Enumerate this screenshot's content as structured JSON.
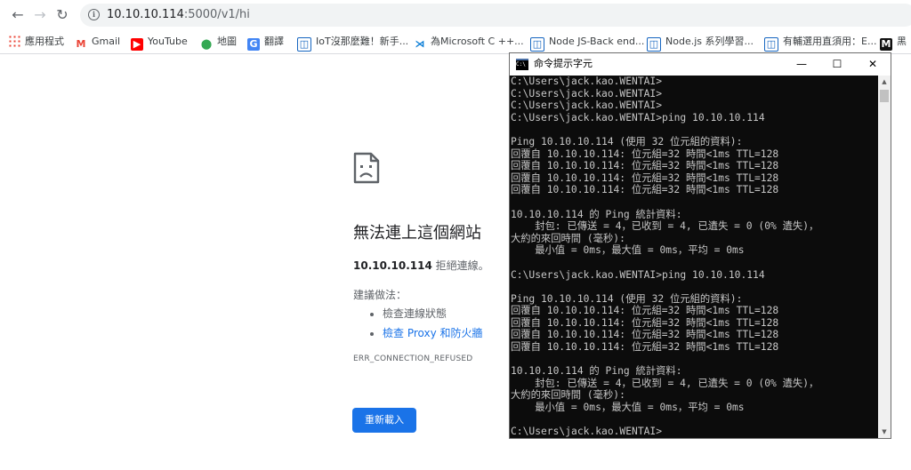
{
  "browser": {
    "nav": {
      "back": "←",
      "forward": "→",
      "reload": "↻"
    },
    "url_host": "10.10.10.114",
    "url_rest": ":5000/v1/hi",
    "bookmarks": [
      {
        "label": "應用程式",
        "icon": "apps-icon"
      },
      {
        "label": "Gmail",
        "icon": "gmail-icon"
      },
      {
        "label": "YouTube",
        "icon": "youtube-icon"
      },
      {
        "label": "地圖",
        "icon": "maps-icon"
      },
      {
        "label": "翻譯",
        "icon": "translate-icon"
      },
      {
        "label": "IoT沒那麼難！新手...",
        "icon": "site-icon"
      },
      {
        "label": "為Microsoft C ++...",
        "icon": "vscode-icon"
      },
      {
        "label": "Node JS-Back end...",
        "icon": "site-icon"
      },
      {
        "label": "Node.js 系列學習...",
        "icon": "site-icon"
      },
      {
        "label": "有輔選用直須用：E...",
        "icon": "site-icon"
      },
      {
        "label": "黑",
        "icon": "dark-site-icon"
      }
    ]
  },
  "error_page": {
    "title": "無法連上這個網站",
    "host": "10.10.10.114",
    "message": " 拒絕連線。",
    "suggestions_label": "建議做法：",
    "suggestions": [
      "檢查連線狀態",
      "檢查 Proxy 和防火牆"
    ],
    "error_code": "ERR_CONNECTION_REFUSED",
    "reload_label": "重新載入"
  },
  "cmd_window": {
    "title": "命令提示字元",
    "buttons": {
      "minimize": "—",
      "maximize": "☐",
      "close": "✕"
    },
    "lines": [
      "C:\\Users\\jack.kao.WENTAI>",
      "C:\\Users\\jack.kao.WENTAI>",
      "C:\\Users\\jack.kao.WENTAI>",
      "C:\\Users\\jack.kao.WENTAI>ping 10.10.10.114",
      "",
      "Ping 10.10.10.114 (使用 32 位元組的資料):",
      "回覆自 10.10.10.114: 位元組=32 時間<1ms TTL=128",
      "回覆自 10.10.10.114: 位元組=32 時間<1ms TTL=128",
      "回覆自 10.10.10.114: 位元組=32 時間<1ms TTL=128",
      "回覆自 10.10.10.114: 位元組=32 時間<1ms TTL=128",
      "",
      "10.10.10.114 的 Ping 統計資料:",
      "    封包: 已傳送 = 4，已收到 = 4, 已遺失 = 0 (0% 遺失)，",
      "大約的來回時間 (毫秒):",
      "    最小值 = 0ms，最大值 = 0ms，平均 = 0ms",
      "",
      "C:\\Users\\jack.kao.WENTAI>ping 10.10.10.114",
      "",
      "Ping 10.10.10.114 (使用 32 位元組的資料):",
      "回覆自 10.10.10.114: 位元組=32 時間<1ms TTL=128",
      "回覆自 10.10.10.114: 位元組=32 時間<1ms TTL=128",
      "回覆自 10.10.10.114: 位元組=32 時間<1ms TTL=128",
      "回覆自 10.10.10.114: 位元組=32 時間<1ms TTL=128",
      "",
      "10.10.10.114 的 Ping 統計資料:",
      "    封包: 已傳送 = 4，已收到 = 4, 已遺失 = 0 (0% 遺失)，",
      "大約的來回時間 (毫秒):",
      "    最小值 = 0ms，最大值 = 0ms，平均 = 0ms",
      "",
      "C:\\Users\\jack.kao.WENTAI>"
    ]
  }
}
